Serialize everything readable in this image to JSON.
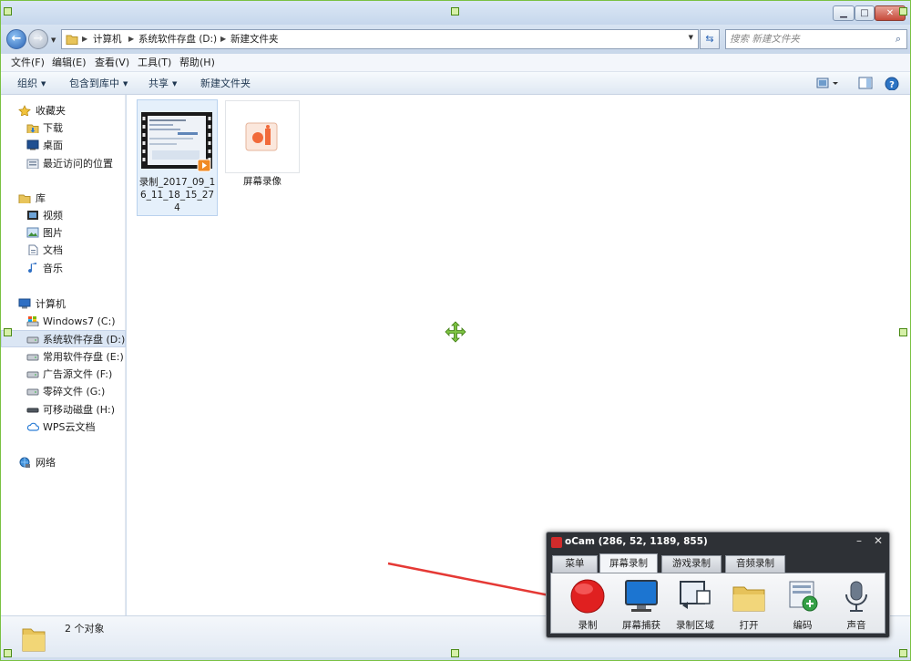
{
  "titlebar": {
    "minimize_glyph": "▁",
    "maximize_glyph": "□",
    "close_glyph": "✕"
  },
  "address": {
    "crumbs": [
      "计算机",
      "系统软件存盘 (D:)",
      "新建文件夹"
    ],
    "search_placeholder": "搜索 新建文件夹"
  },
  "menu": [
    "文件(F)",
    "编辑(E)",
    "查看(V)",
    "工具(T)",
    "帮助(H)"
  ],
  "commands": {
    "organize": "组织",
    "include_library": "包含到库中",
    "share": "共享",
    "new_folder": "新建文件夹"
  },
  "nav": {
    "favorites": "收藏夹",
    "downloads": "下载",
    "desktop": "桌面",
    "recent": "最近访问的位置",
    "libraries": "库",
    "videos": "视频",
    "pictures": "图片",
    "documents": "文档",
    "music": "音乐",
    "computer": "计算机",
    "drive_c": "Windows7 (C:)",
    "drive_d": "系统软件存盘 (D:)",
    "drive_e": "常用软件存盘 (E:)",
    "drive_f": "广告源文件 (F:)",
    "drive_g": "零碎文件 (G:)",
    "drive_h": "可移动磁盘 (H:)",
    "wps_cloud": "WPS云文档",
    "network": "网络"
  },
  "files": [
    {
      "name": "录制_2017_09_16_11_18_15_274",
      "type": "video"
    },
    {
      "name": "屏幕录像",
      "type": "app"
    }
  ],
  "status": {
    "count": "2 个对象"
  },
  "ocam": {
    "title": "oCam (286, 52, 1189, 855)",
    "tabs": [
      "菜单",
      "屏幕录制",
      "游戏录制",
      "音频录制"
    ],
    "tools": [
      "录制",
      "屏幕捕获",
      "录制区域",
      "打开",
      "编码",
      "声音"
    ]
  },
  "colors": {
    "selection_border": "#7ac143",
    "accent_blue": "#2a63b4",
    "record_red": "#e02020",
    "arrow_red": "#e53935"
  }
}
